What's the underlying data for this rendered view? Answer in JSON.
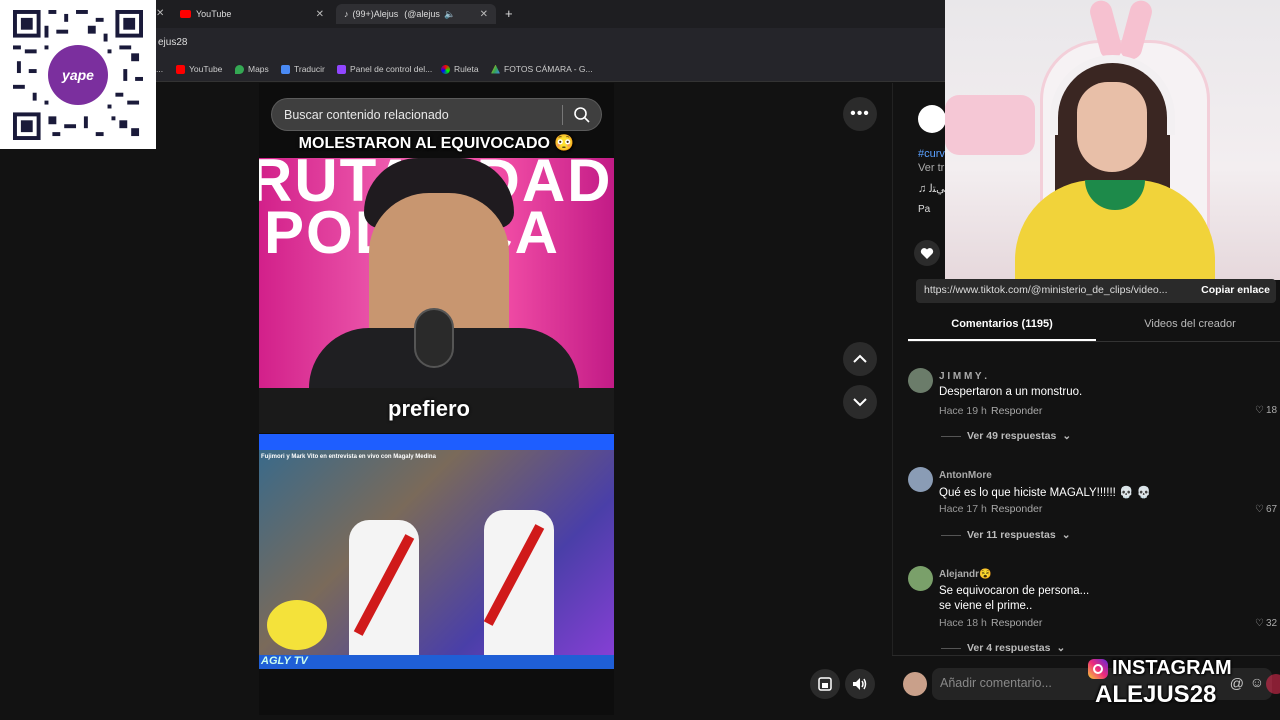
{
  "browser": {
    "tabs": [
      {
        "label": "YouTube"
      },
      {
        "label": "(99+)Alejus",
        "suffix": "(@alejus"
      }
    ],
    "new_tab": "+",
    "url_fragment": "ejus28",
    "bookmarks": [
      "YouTube",
      "Maps",
      "Traducir",
      "Panel de control del...",
      "Ruleta",
      "FOTOS CÁMARA - G..."
    ]
  },
  "qr": {
    "brand": "yape"
  },
  "video": {
    "search_placeholder": "Buscar contenido relacionado",
    "caption_top": "MOLESTARON AL EQUIVOCADO 😳",
    "caption_mid": "prefiero",
    "scene1_text": [
      "RUTALIDAD",
      "POLÍTICA"
    ],
    "scene3_text": "Fujimori y Mark Vito en entrevista en vivo con Magaly Medina",
    "channel_logo": "AGLY TV"
  },
  "controls": {
    "more": "•••"
  },
  "panel": {
    "hashtag": "#curv",
    "see_translation": "Ver tr",
    "music": "♫ ﻲﺘﻟ",
    "pa_label": "Pa",
    "link_url": "https://www.tiktok.com/@ministerio_de_clips/video...",
    "copy_link": "Copiar enlace",
    "tab_comments": "Comentarios (1195)",
    "tab_videos": "Videos del creador",
    "comments": [
      {
        "user": "J I M M Y .",
        "text": "Despertaron a un monstruo.",
        "time": "Hace 19 h",
        "reply": "Responder",
        "likes": "18",
        "more": "Ver 49 respuestas",
        "avatar_color": "#6b7c6a"
      },
      {
        "user": "AntonMore",
        "text": "Qué es lo que hiciste MAGALY!!!!!! 💀 💀",
        "time": "Hace 17 h",
        "reply": "Responder",
        "likes": "67",
        "more": "Ver 11 respuestas",
        "avatar_color": "#8a9cb5"
      },
      {
        "user": "Alejandr😵",
        "text": "Se equivocaron de persona...\nse viene el prime..",
        "time": "Hace 18 h",
        "reply": "Responder",
        "likes": "32",
        "more": "Ver 4 respuestas",
        "avatar_color": "#7aa06a"
      }
    ],
    "add_comment_placeholder": "Añadir comentario..."
  },
  "overlay": {
    "instagram_label": "INSTAGRAM",
    "handle": "ALEJUS28"
  }
}
